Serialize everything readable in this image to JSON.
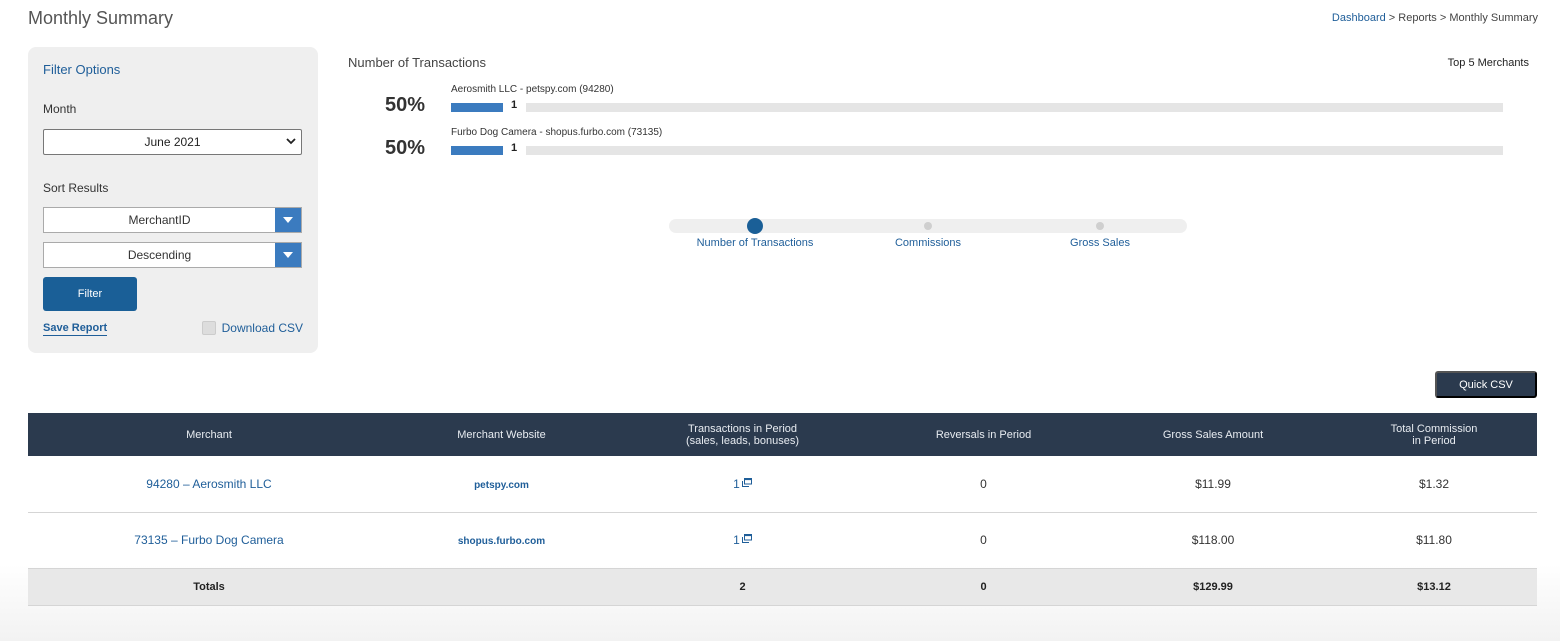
{
  "header": {
    "title": "Monthly Summary",
    "breadcrumb": {
      "link": "Dashboard",
      "sep1": " > ",
      "item2": "Reports",
      "sep2": " > ",
      "current": "Monthly Summary"
    }
  },
  "filter": {
    "title": "Filter Options",
    "month_label": "Month",
    "month_value": "June 2021",
    "sort_label": "Sort Results",
    "sort_field": "MerchantID",
    "sort_order": "Descending",
    "filter_button": "Filter",
    "save_report": "Save Report",
    "download_csv": "Download CSV"
  },
  "chart_data": {
    "type": "bar",
    "title": "Number of Transactions",
    "legend_title": "Top 5 Merchants",
    "categories": [
      "Aerosmith LLC - petspy.com (94280)",
      "Furbo Dog Camera - shopus.furbo.com (73135)"
    ],
    "values": [
      1,
      1
    ],
    "percents": [
      "50%",
      "50%"
    ],
    "max": 2
  },
  "slider": {
    "items": [
      "Number of Transactions",
      "Commissions",
      "Gross Sales"
    ],
    "active_index": 0
  },
  "quick_csv": "Quick CSV",
  "table": {
    "headers": {
      "merchant": "Merchant",
      "website": "Merchant Website",
      "transactions_line1": "Transactions in Period",
      "transactions_line2": "(sales, leads, bonuses)",
      "reversals": "Reversals in Period",
      "gross": "Gross Sales Amount",
      "commission_line1": "Total Commission",
      "commission_line2": "in Period"
    },
    "rows": [
      {
        "merchant": "94280 – Aerosmith LLC",
        "website": "petspy.com",
        "transactions": "1",
        "reversals": "0",
        "gross": "$11.99",
        "commission": "$1.32"
      },
      {
        "merchant": "73135 – Furbo Dog Camera",
        "website": "shopus.furbo.com",
        "transactions": "1",
        "reversals": "0",
        "gross": "$118.00",
        "commission": "$11.80"
      }
    ],
    "totals": {
      "label": "Totals",
      "transactions": "2",
      "reversals": "0",
      "gross": "$129.99",
      "commission": "$13.12"
    }
  },
  "colors": {
    "accent": "#1a5f97",
    "bar": "#3b7bbf",
    "header_bg": "#2b3a4e"
  }
}
